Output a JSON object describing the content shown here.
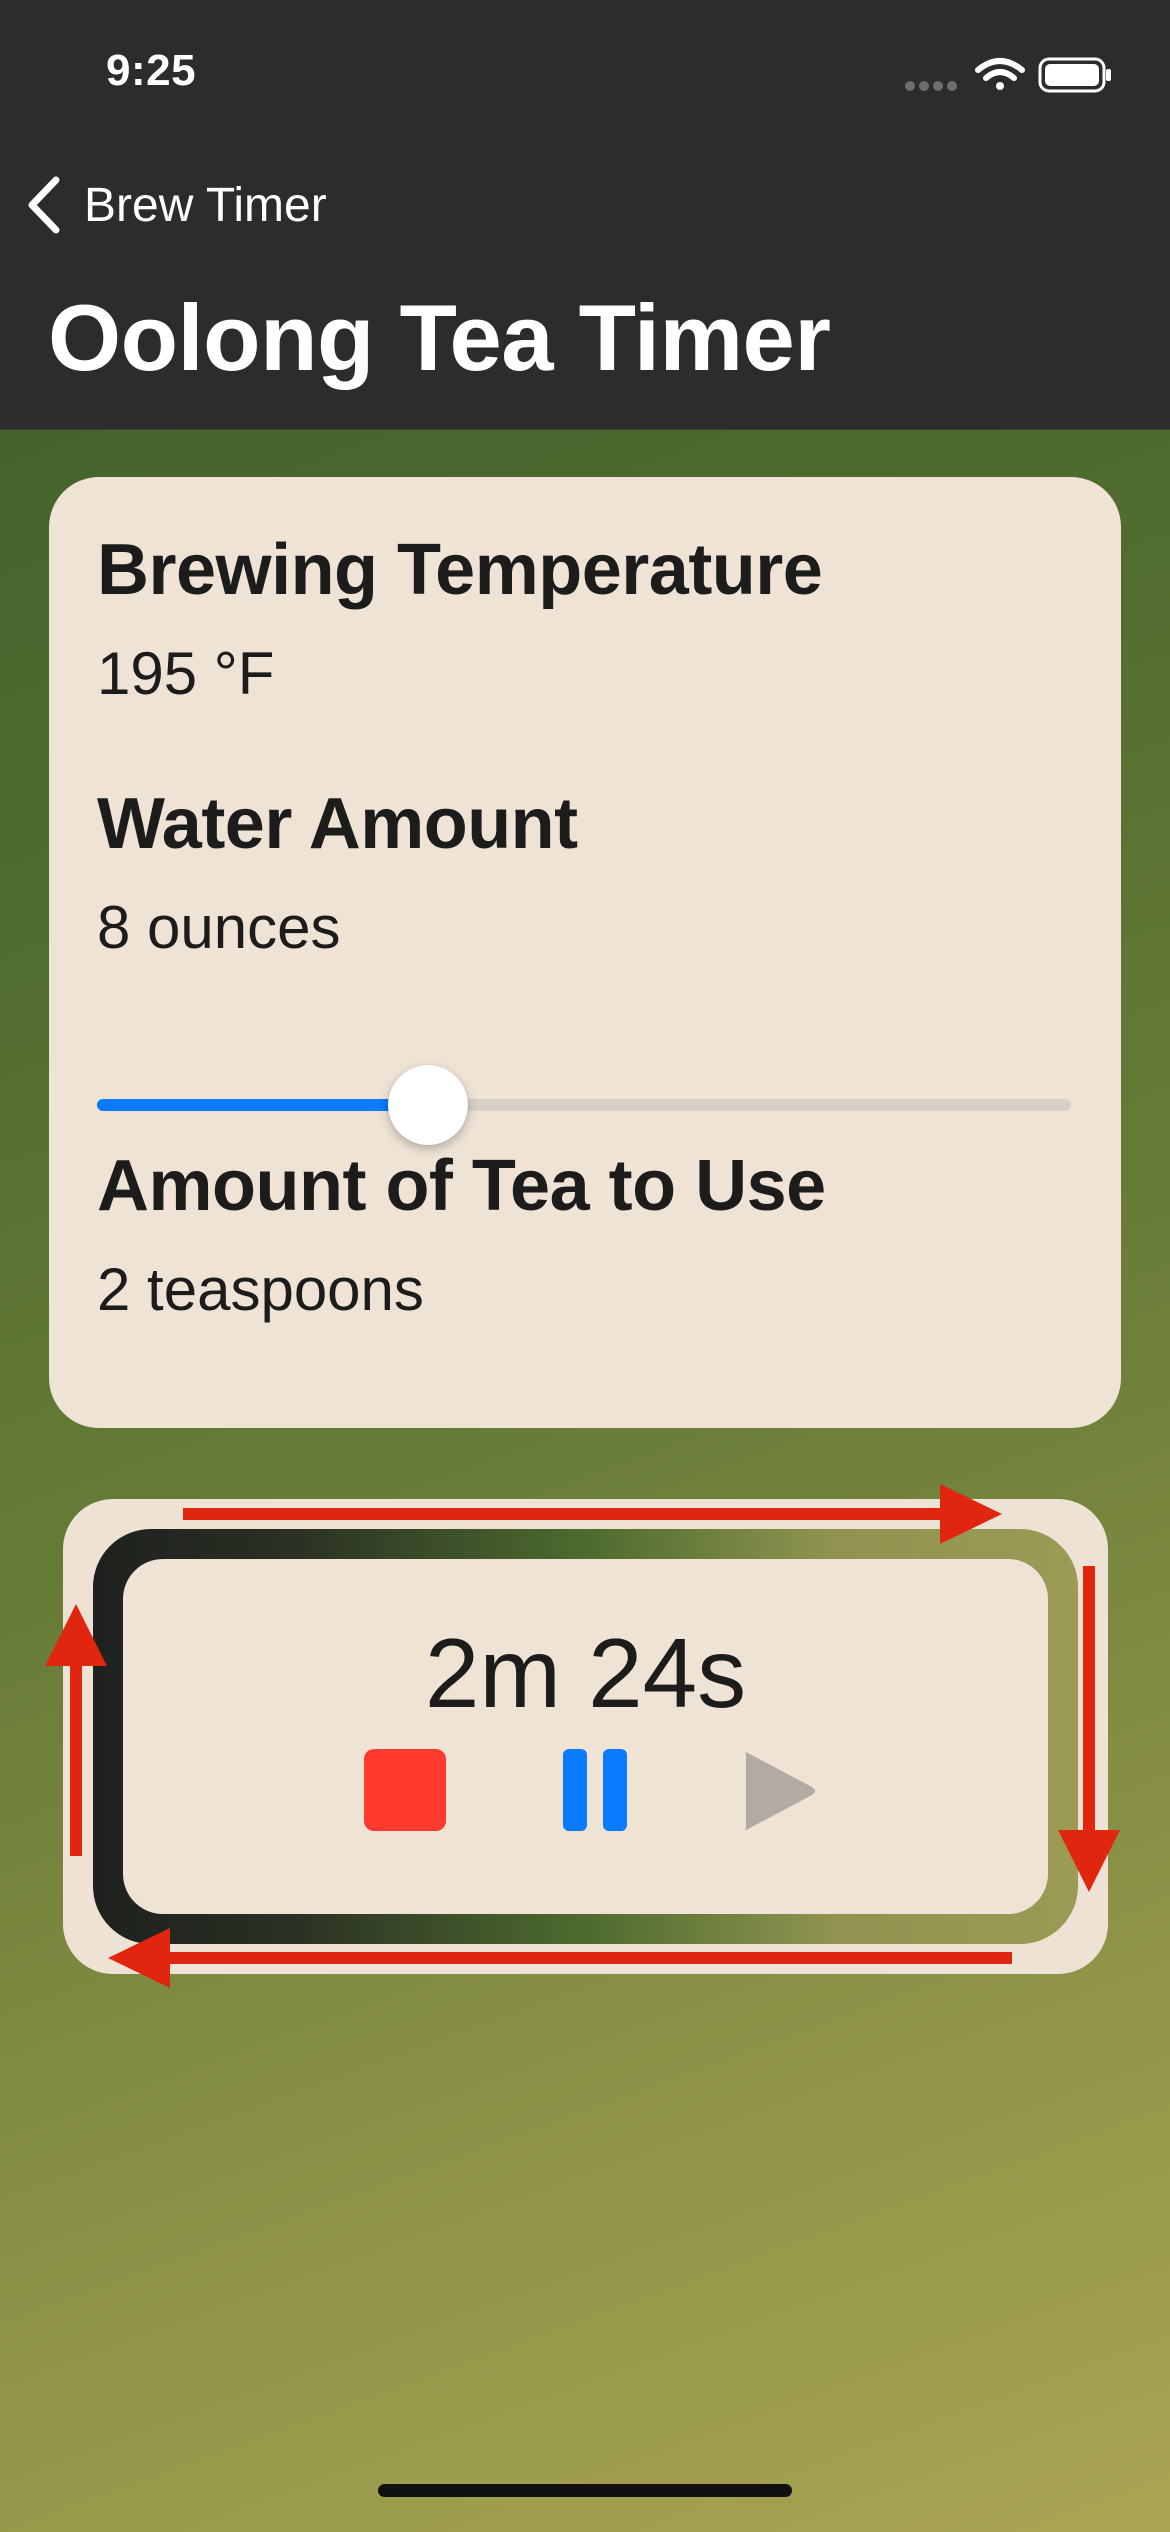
{
  "status_bar": {
    "time": "9:25",
    "icons": [
      "signal-dots-icon",
      "wifi-icon",
      "battery-icon"
    ]
  },
  "nav": {
    "back_label": "Brew Timer",
    "title": "Oolong Tea Timer"
  },
  "info_card": {
    "temperature_label": "Brewing Temperature",
    "temperature_value": "195 °F",
    "water_label": "Water Amount",
    "water_value": "8 ounces",
    "water_slider_fraction": 0.34,
    "tea_label": "Amount of Tea to Use",
    "tea_value": "2 teaspoons"
  },
  "timer": {
    "time_remaining": "2m 24s",
    "controls": [
      "stop-icon",
      "pause-icon",
      "play-icon"
    ]
  },
  "colors": {
    "accent_blue": "#0a7aff",
    "stop_red": "#ff3b30",
    "play_disabled": "#b3aba3",
    "card_background": "#efe3d6",
    "annotation_arrows": "#e0260f"
  }
}
